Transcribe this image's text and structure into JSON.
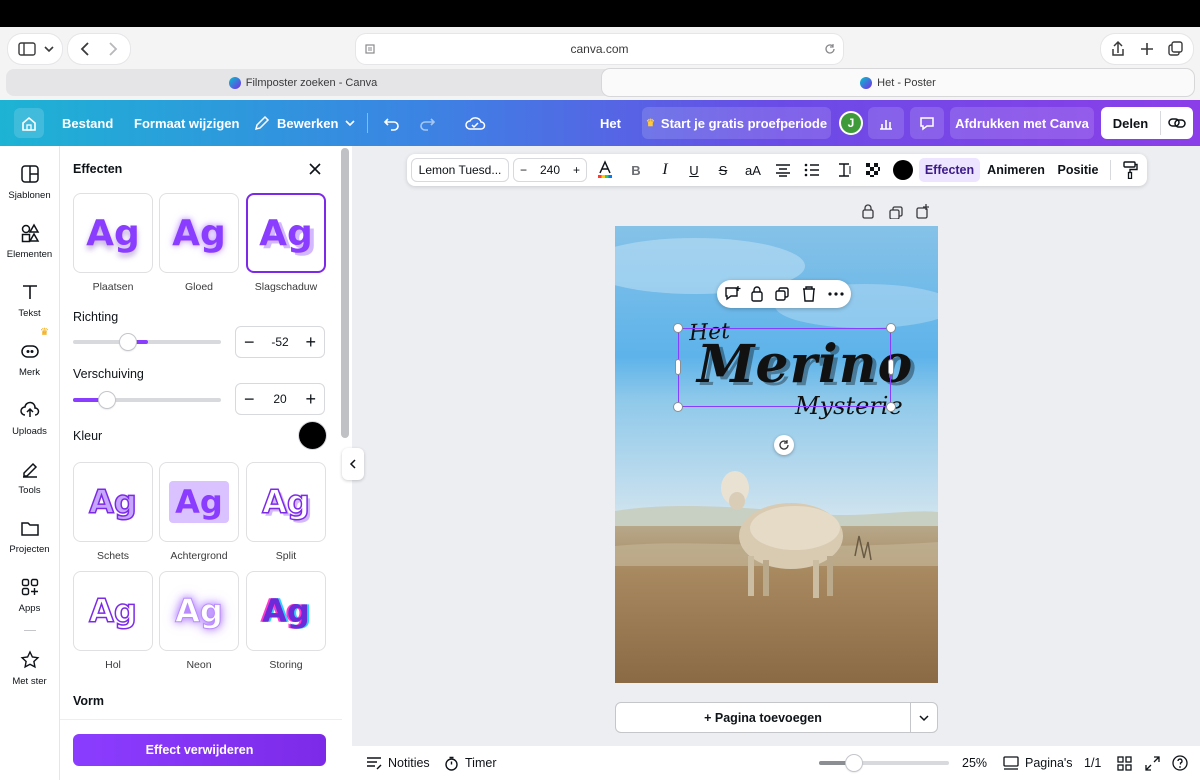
{
  "browser": {
    "url": "canva.com",
    "tabs": [
      {
        "label": "Filmposter zoeken - Canva"
      },
      {
        "label": "Het - Poster"
      }
    ]
  },
  "toolbar": {
    "file": "Bestand",
    "resize": "Formaat wijzigen",
    "edit": "Bewerken",
    "doc_title": "Het",
    "trial": "Start je gratis proefperiode",
    "avatar_initial": "J",
    "print": "Afdrukken met Canva",
    "share": "Delen"
  },
  "rail": {
    "items": [
      {
        "label": "Sjablonen"
      },
      {
        "label": "Elementen"
      },
      {
        "label": "Tekst"
      },
      {
        "label": "Merk"
      },
      {
        "label": "Uploads"
      },
      {
        "label": "Tools"
      },
      {
        "label": "Projecten"
      },
      {
        "label": "Apps"
      },
      {
        "label": "Met ster"
      }
    ]
  },
  "panel": {
    "title": "Effecten",
    "sample": "Ag",
    "shadow_effects": [
      {
        "label": "Plaatsen"
      },
      {
        "label": "Gloed"
      },
      {
        "label": "Slagschaduw"
      }
    ],
    "direction_label": "Richting",
    "direction_value": "-52",
    "offset_label": "Verschuiving",
    "offset_value": "20",
    "color_label": "Kleur",
    "color_value": "#000000",
    "style_effects": [
      {
        "label": "Schets"
      },
      {
        "label": "Achtergrond"
      },
      {
        "label": "Split"
      },
      {
        "label": "Hol"
      },
      {
        "label": "Neon"
      },
      {
        "label": "Storing"
      }
    ],
    "shape_label": "Vorm",
    "remove_button": "Effect verwijderen"
  },
  "format_toolbar": {
    "font": "Lemon Tuesd...",
    "font_size": "240",
    "case_button": "aA",
    "effects": "Effecten",
    "animate": "Animeren",
    "position": "Positie"
  },
  "poster": {
    "line1": "Het",
    "line2": "Merino",
    "line3": "Mysterie"
  },
  "canvas": {
    "add_page": "+ Pagina toevoegen"
  },
  "bottom": {
    "notes": "Notities",
    "timer": "Timer",
    "zoom": "25%",
    "pages": "Pagina's",
    "page_count": "1/1"
  },
  "colors": {
    "accent": "#7d2ae8",
    "toolbar_start": "#1db3d4",
    "toolbar_end": "#8b3ee8"
  }
}
